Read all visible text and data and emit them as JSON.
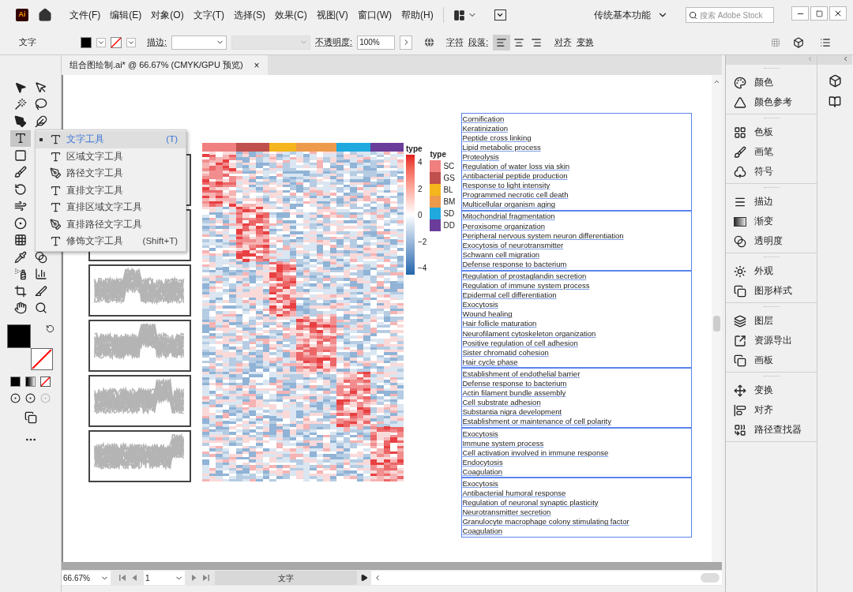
{
  "app": {
    "logo": "Ai"
  },
  "menu": [
    "文件(F)",
    "编辑(E)",
    "对象(O)",
    "文字(T)",
    "选择(S)",
    "效果(C)",
    "视图(V)",
    "窗口(W)",
    "帮助(H)"
  ],
  "workspace": "传统基本功能",
  "search": {
    "placeholder": "搜索 Adobe Stock"
  },
  "control_bar": {
    "label": "文字",
    "stroke_label": "描边:",
    "opacity_label": "不透明度:",
    "opacity": "100%",
    "character": "字符",
    "paragraph": "段落:",
    "align_buttons": [
      {
        "selected": true
      },
      {
        "selected": false
      },
      {
        "selected": false
      }
    ],
    "align": "对齐",
    "transform": "变换"
  },
  "document_tab": {
    "title": "组合图绘制.ai* @ 66.67% (CMYK/GPU 预览)",
    "close": "×"
  },
  "tools": [
    {
      "selected": false
    },
    {
      "selected": false
    },
    {
      "selected": false
    },
    {
      "selected": false
    },
    {
      "selected": false
    },
    {
      "selected": false
    },
    {
      "selected": true
    },
    {
      "selected": false
    },
    {
      "selected": false
    },
    {
      "selected": false
    },
    {
      "selected": false
    },
    {
      "selected": false
    },
    {
      "selected": false
    },
    {
      "selected": false
    },
    {
      "selected": false
    },
    {
      "selected": false
    },
    {
      "selected": false
    },
    {
      "selected": false
    },
    {
      "selected": false
    },
    {
      "selected": false
    },
    {
      "selected": false
    }
  ],
  "flyout": [
    {
      "label": "文字工具",
      "shortcut": "(T)",
      "selected": true
    },
    {
      "label": "区域文字工具",
      "selected": false
    },
    {
      "label": "路径文字工具",
      "selected": false
    },
    {
      "label": "直排文字工具",
      "selected": false
    },
    {
      "label": "直排区域文字工具",
      "selected": false
    },
    {
      "label": "直排路径文字工具",
      "selected": false
    },
    {
      "label": "修饰文字工具",
      "shortcut": "(Shift+T)",
      "selected": false
    }
  ],
  "figure": {
    "colorbar": {
      "title": "type",
      "ticks": [
        "4",
        "2",
        "0",
        "−2",
        "−4"
      ]
    },
    "type_legend": {
      "title": "type",
      "items": [
        {
          "label": "SC",
          "color": "#f08080"
        },
        {
          "label": "GS",
          "color": "#c0504d"
        },
        {
          "label": "BL",
          "color": "#f4b61c"
        },
        {
          "label": "BM",
          "color": "#ee9a4d"
        },
        {
          "label": "SD",
          "color": "#1fa9df"
        },
        {
          "label": "DD",
          "color": "#6a3d9a"
        }
      ]
    },
    "text_frames": [
      {
        "lines": [
          "Cornification",
          "Keratinization",
          "Peptide cross linking",
          "Lipid metabolic process",
          "Proteolysis",
          "Regulation of water loss via skin",
          "Antibacterial peptide production",
          "Response to light intensity",
          "Programmed necrotic cell death",
          "Multicellular organism aging"
        ]
      },
      {
        "lines": [
          "Mitochondrial fragmentation",
          "Peroxisome organization",
          "Peripheral nervous system neuron differentiation",
          "Exocytosis of neurotransmitter",
          "Schwann cell migration",
          "Defense response to bacterium"
        ]
      },
      {
        "lines": [
          "Regulation of prostaglandin secretion",
          "Regulation of immune system process",
          "Epidermal cell differentiation",
          "Exocytosis",
          "Wound healing",
          "Hair follicle maturation",
          "Neurofilament cytoskeleton organization",
          "Positive regulation of cell adhesion",
          "Sister chromatid cohesion",
          "Hair cycle phase"
        ]
      },
      {
        "lines": [
          "Establishment of endothelial barrier",
          "Defense response to bacterium",
          "Actin filament bundle assembly",
          "Cell substrate adhesion",
          "Substantia nigra development",
          "Establishment or maintenance of cell polarity"
        ]
      },
      {
        "lines": [
          "Exocytosis",
          "Immune system process",
          "Cell activation involved in immune response",
          "Endocytosis",
          "Coagulation"
        ]
      },
      {
        "lines": [
          "Exocytosis",
          "Antibacterial humoral response",
          "Regulation of neuronal synaptic plasticity",
          "Neurotransmitter secretion",
          "Granulocyte macrophage colony stimulating factor",
          "Coagulation"
        ]
      }
    ]
  },
  "panels": [
    {
      "items": [
        "颜色",
        "颜色参考"
      ]
    },
    {
      "items": [
        "色板",
        "画笔",
        "符号"
      ]
    },
    {
      "items": [
        "描边",
        "渐变",
        "透明度"
      ]
    },
    {
      "items": [
        "外观",
        "图形样式"
      ]
    },
    {
      "items": [
        "图层",
        "资源导出",
        "画板"
      ]
    },
    {
      "items": [
        "变换",
        "对齐",
        "路径查找器"
      ]
    }
  ],
  "status_bar": {
    "zoom": "66.67%",
    "page": "1",
    "tool": "文字"
  }
}
